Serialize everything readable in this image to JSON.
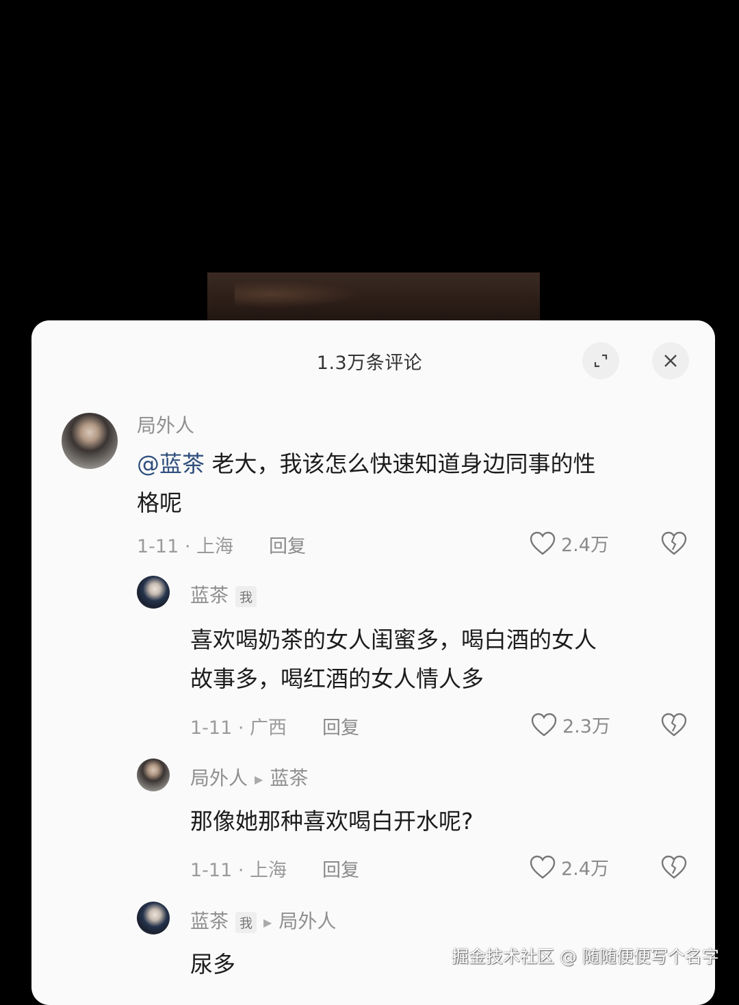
{
  "header": {
    "title": "1.3万条评论"
  },
  "comments": [
    {
      "user": "局外人",
      "mention": "@蓝茶",
      "text_line1": " 老大，我该怎么快速知道身边同事的性",
      "text_line2": "格呢",
      "meta": "1-11 · 上海",
      "reply_label": "回复",
      "likes": "2.4万"
    },
    {
      "user": "蓝茶",
      "tag": "我",
      "text_line1": "喜欢喝奶茶的女人闺蜜多，喝白酒的女人",
      "text_line2": "故事多，喝红酒的女人情人多",
      "meta": "1-11 · 广西",
      "reply_label": "回复",
      "likes": "2.3万"
    },
    {
      "user": "局外人",
      "reply_to": "蓝茶",
      "text_line1": "那像她那种喜欢喝白开水呢?",
      "meta": "1-11 · 上海",
      "reply_label": "回复",
      "likes": "2.4万"
    },
    {
      "user": "蓝茶",
      "tag": "我",
      "reply_to": "局外人",
      "text_line1": "尿多"
    }
  ],
  "icons": {
    "expand": "expand-icon",
    "close": "close-icon",
    "like": "heart-icon",
    "dislike": "broken-heart-icon",
    "reply_arrow": "triangle-right-icon"
  },
  "watermark": "掘金技术社区 @ 随随便便写个名字"
}
